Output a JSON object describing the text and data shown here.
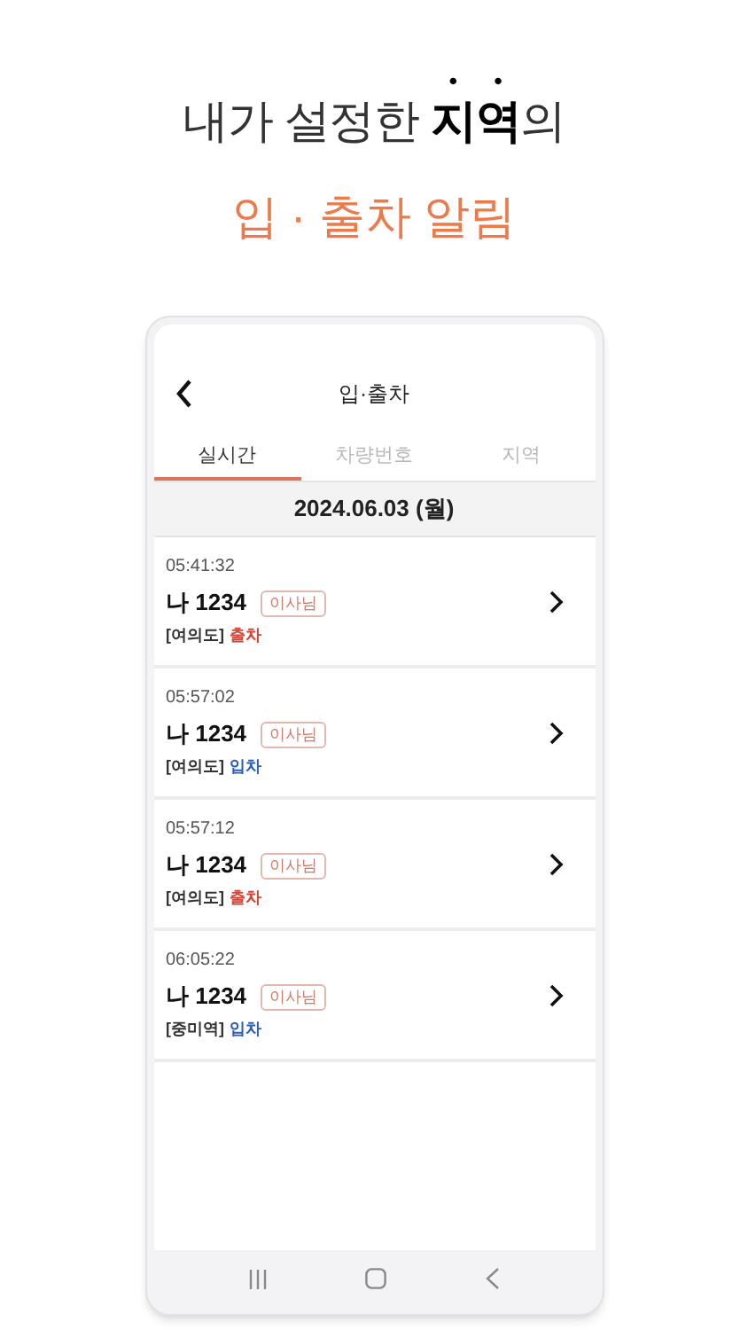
{
  "headline": "내가 설정한 **지역**의",
  "subheadline": "입 · 출차 알림",
  "app": {
    "title": "입·출차",
    "tabs": [
      {
        "label": "실시간",
        "selected": true
      },
      {
        "label": "차량번호",
        "selected": false
      },
      {
        "label": "지역",
        "selected": false
      }
    ],
    "date": "2024.06.03 (월)",
    "entries": [
      {
        "time": "05:41:32",
        "plate": "나 1234",
        "tag": "이사님",
        "area": "[여의도]",
        "status": "출차",
        "kind": "exit"
      },
      {
        "time": "05:57:02",
        "plate": "나 1234",
        "tag": "이사님",
        "area": "[여의도]",
        "status": "입차",
        "kind": "entry"
      },
      {
        "time": "05:57:12",
        "plate": "나 1234",
        "tag": "이사님",
        "area": "[여의도]",
        "status": "출차",
        "kind": "exit"
      },
      {
        "time": "06:05:22",
        "plate": "나 1234",
        "tag": "이사님",
        "area": "[중미역]",
        "status": "입차",
        "kind": "entry"
      }
    ]
  }
}
